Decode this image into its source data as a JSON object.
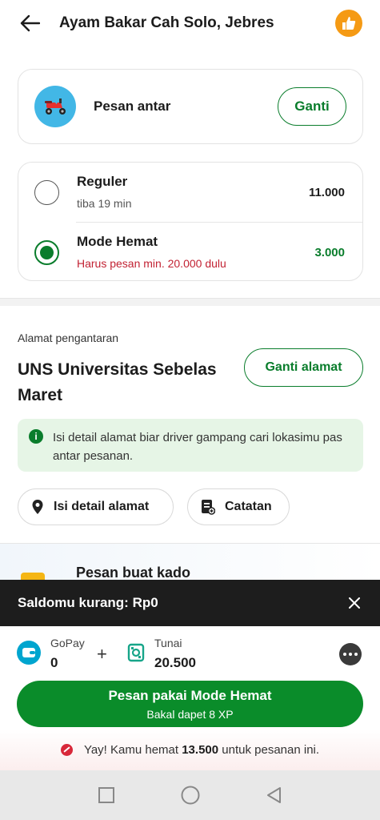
{
  "header": {
    "title": "Ayam Bakar Cah Solo, Jebres"
  },
  "delivery": {
    "label": "Pesan antar",
    "change_label": "Ganti"
  },
  "options": [
    {
      "name": "Reguler",
      "sub": "tiba 19 min",
      "price": "11.000",
      "selected": false
    },
    {
      "name": "Mode Hemat",
      "sub": "Harus pesan min. 20.000 dulu",
      "price": "3.000",
      "selected": true
    }
  ],
  "address": {
    "section_label": "Alamat pengantaran",
    "name": "UNS Universitas Sebelas Maret",
    "change_label": "Ganti alamat",
    "info": "Isi detail alamat biar driver gampang cari lokasimu pas antar pesanan.",
    "info_icon": "i",
    "detail_chip": "Isi detail alamat",
    "note_chip": "Catatan"
  },
  "gift": {
    "title": "Pesan buat kado"
  },
  "balance_warning": {
    "text": "Saldomu kurang: Rp0"
  },
  "payment": {
    "gopay_label": "GoPay",
    "gopay_value": "0",
    "plus": "+",
    "tunai_label": "Tunai",
    "tunai_value": "20.500"
  },
  "order_button": {
    "label": "Pesan pakai Mode Hemat",
    "sub": "Bakal dapet 8 XP"
  },
  "savings": {
    "prefix": "Yay! Kamu hemat ",
    "amount": "13.500",
    "suffix": " untuk pesanan ini."
  },
  "colors": {
    "brand_green": "#0a8c2a",
    "warning_red": "#c22233",
    "accent_orange": "#f59a14",
    "scooter_blue": "#42b7e6"
  }
}
